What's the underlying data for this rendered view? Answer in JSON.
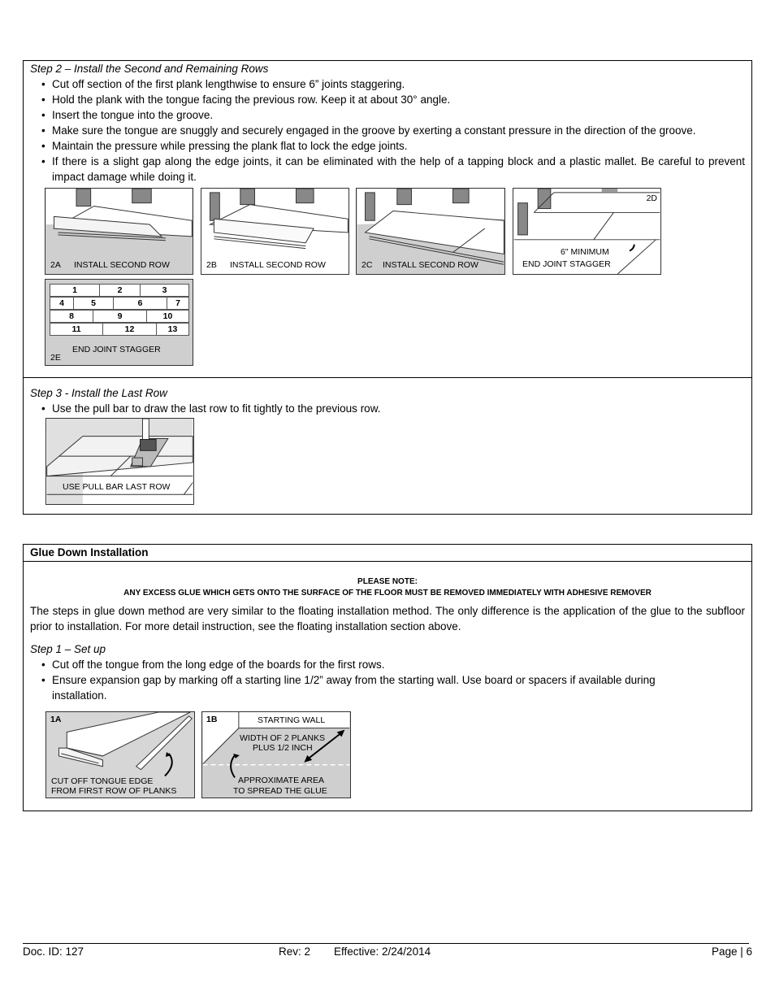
{
  "step2": {
    "title": "Step 2 – Install the Second and Remaining Rows",
    "bullets": [
      "Cut off section of the first plank lengthwise to ensure 6” joints staggering.",
      "Hold the plank with the tongue facing the previous row.  Keep it at about 30° angle.",
      "Insert the tongue into the groove.",
      "Make sure the tongue are snuggly and securely engaged in the groove by exerting a constant pressure in the direction of the groove.",
      "Maintain the pressure while pressing the plank flat to lock the edge joints.",
      "If there is a slight gap along the edge joints, it can be eliminated with the help of a tapping block and a plastic mallet.  Be careful to prevent impact damage while doing it."
    ],
    "figures": {
      "2A": {
        "id": "2A",
        "caption": "INSTALL SECOND ROW"
      },
      "2B": {
        "id": "2B",
        "caption": "INSTALL SECOND ROW"
      },
      "2C": {
        "id": "2C",
        "caption": "INSTALL SECOND ROW"
      },
      "2D": {
        "id": "2D",
        "caption_line1": "6\" MINIMUM",
        "caption_line2": "END JOINT STAGGER"
      },
      "2E": {
        "id": "2E",
        "caption": "END JOINT STAGGER",
        "rows": [
          [
            "1",
            "2",
            "3"
          ],
          [
            "4",
            "5",
            "6",
            "7"
          ],
          [
            "8",
            "9",
            "10"
          ],
          [
            "11",
            "12",
            "13"
          ]
        ]
      }
    }
  },
  "step3": {
    "title": "Step 3 - Install the Last Row",
    "bullets": [
      "Use the pull bar to draw the last row to fit tightly to the previous row."
    ],
    "figure": {
      "caption": "USE PULL BAR LAST ROW"
    }
  },
  "glue": {
    "header": "Glue Down Installation",
    "note_title": "PLEASE NOTE:",
    "note_text": "ANY EXCESS GLUE WHICH GETS ONTO THE SURFACE OF THE FLOOR MUST BE REMOVED IMMEDIATELY WITH ADHESIVE REMOVER",
    "intro": "The steps in glue down method are very similar to the floating installation method.  The only difference is the application of the glue to the subfloor prior to installation.  For more detail instruction, see the floating installation section above.",
    "step1_title": "Step 1 – Set up",
    "step1_bullets": [
      "Cut off the tongue from the long edge of the boards for the first rows.",
      "Ensure expansion gap by marking off a starting line 1/2” away from the starting wall.  Use board or spacers if available during installation."
    ],
    "figures": {
      "1A": {
        "id": "1A",
        "caption_line1": "CUT OFF TONGUE EDGE",
        "caption_line2": "FROM FIRST ROW OF PLANKS"
      },
      "1B": {
        "id": "1B",
        "wall": "STARTING WALL",
        "width_line1": "WIDTH OF 2 PLANKS",
        "width_line2": "PLUS 1/2 INCH",
        "area_line1": "APPROXIMATE AREA",
        "area_line2": "TO SPREAD THE GLUE"
      }
    }
  },
  "footer": {
    "doc_id": "Doc. ID: 127",
    "rev": "Rev:  2",
    "effective": "Effective: 2/24/2014",
    "page": "Page | 6"
  }
}
